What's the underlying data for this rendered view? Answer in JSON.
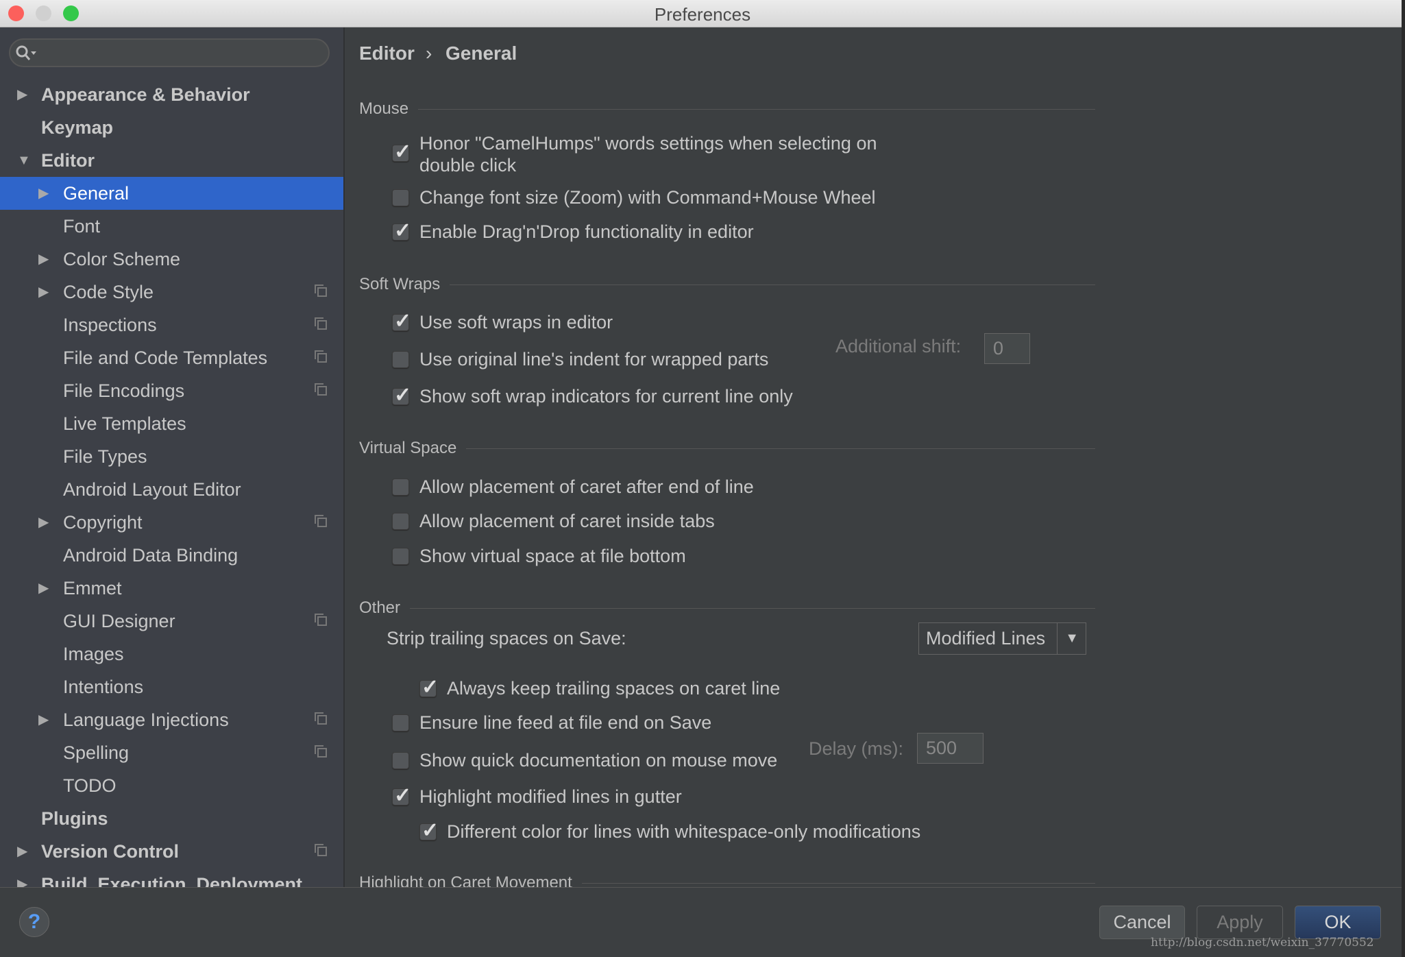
{
  "window": {
    "title": "Preferences"
  },
  "colors": {
    "accent": "#2f65ca",
    "close": "#fc605c",
    "minimize": "#d0d0d0",
    "zoom": "#34c84a"
  },
  "search": {
    "placeholder": "",
    "icon": "search-icon"
  },
  "sidebar": {
    "items": [
      {
        "label": "Appearance & Behavior",
        "level": 0,
        "arrow": "right",
        "bold": true
      },
      {
        "label": "Keymap",
        "level": 0,
        "bold": true
      },
      {
        "label": "Editor",
        "level": 0,
        "arrow": "down",
        "bold": true
      },
      {
        "label": "General",
        "level": 1,
        "arrow": "right",
        "selected": true
      },
      {
        "label": "Font",
        "level": 1
      },
      {
        "label": "Color Scheme",
        "level": 1,
        "arrow": "right"
      },
      {
        "label": "Code Style",
        "level": 1,
        "arrow": "right",
        "copy": true
      },
      {
        "label": "Inspections",
        "level": 1,
        "copy": true
      },
      {
        "label": "File and Code Templates",
        "level": 1,
        "copy": true
      },
      {
        "label": "File Encodings",
        "level": 1,
        "copy": true
      },
      {
        "label": "Live Templates",
        "level": 1
      },
      {
        "label": "File Types",
        "level": 1
      },
      {
        "label": "Android Layout Editor",
        "level": 1
      },
      {
        "label": "Copyright",
        "level": 1,
        "arrow": "right",
        "copy": true
      },
      {
        "label": "Android Data Binding",
        "level": 1
      },
      {
        "label": "Emmet",
        "level": 1,
        "arrow": "right"
      },
      {
        "label": "GUI Designer",
        "level": 1,
        "copy": true
      },
      {
        "label": "Images",
        "level": 1
      },
      {
        "label": "Intentions",
        "level": 1
      },
      {
        "label": "Language Injections",
        "level": 1,
        "arrow": "right",
        "copy": true
      },
      {
        "label": "Spelling",
        "level": 1,
        "copy": true
      },
      {
        "label": "TODO",
        "level": 1
      },
      {
        "label": "Plugins",
        "level": 0,
        "bold": true
      },
      {
        "label": "Version Control",
        "level": 0,
        "arrow": "right",
        "bold": true,
        "copy": true
      },
      {
        "label": "Build, Execution, Deployment",
        "level": 0,
        "arrow": "right",
        "bold": true
      }
    ]
  },
  "breadcrumb": {
    "parent": "Editor",
    "separator": "›",
    "current": "General"
  },
  "sections": [
    {
      "title": "Mouse"
    },
    {
      "title": "Soft Wraps"
    },
    {
      "title": "Virtual Space"
    },
    {
      "title": "Other"
    },
    {
      "title": "Highlight on Caret Movement"
    }
  ],
  "options": [
    {
      "label": "Honor \"CamelHumps\" words settings when selecting on",
      "label2": "double click",
      "checked": true,
      "indent": 0
    },
    {
      "label": "Change font size (Zoom) with Command+Mouse Wheel",
      "checked": false,
      "indent": 0
    },
    {
      "label": "Enable Drag'n'Drop functionality in editor",
      "checked": true,
      "indent": 0
    },
    {
      "label": "Use soft wraps in editor",
      "checked": true,
      "indent": 0
    },
    {
      "label": "Use original line's indent for wrapped parts",
      "checked": false,
      "indent": 0
    },
    {
      "label": "Show soft wrap indicators for current line only",
      "checked": true,
      "indent": 0
    },
    {
      "label": "Allow placement of caret after end of line",
      "checked": false,
      "indent": 0
    },
    {
      "label": "Allow placement of caret inside tabs",
      "checked": false,
      "indent": 0
    },
    {
      "label": "Show virtual space at file bottom",
      "checked": false,
      "indent": 0
    },
    {
      "label": "Always keep trailing spaces on caret line",
      "checked": true,
      "indent": 1
    },
    {
      "label": "Ensure line feed at file end on Save",
      "checked": false,
      "indent": 0
    },
    {
      "label": "Show quick documentation on mouse move",
      "checked": false,
      "indent": 0
    },
    {
      "label": "Highlight modified lines in gutter",
      "checked": true,
      "indent": 0
    },
    {
      "label": "Different color for lines with whitespace-only modifications",
      "checked": true,
      "indent": 1
    }
  ],
  "additional_shift": {
    "label": "Additional shift:",
    "value": "0"
  },
  "strip": {
    "label": "Strip trailing spaces on Save:",
    "value": "Modified Lines"
  },
  "delay": {
    "label": "Delay (ms):",
    "value": "500"
  },
  "footer": {
    "help": "?",
    "cancel": "Cancel",
    "apply": "Apply",
    "ok": "OK",
    "watermark": "http://blog.csdn.net/weixin_37770552"
  }
}
